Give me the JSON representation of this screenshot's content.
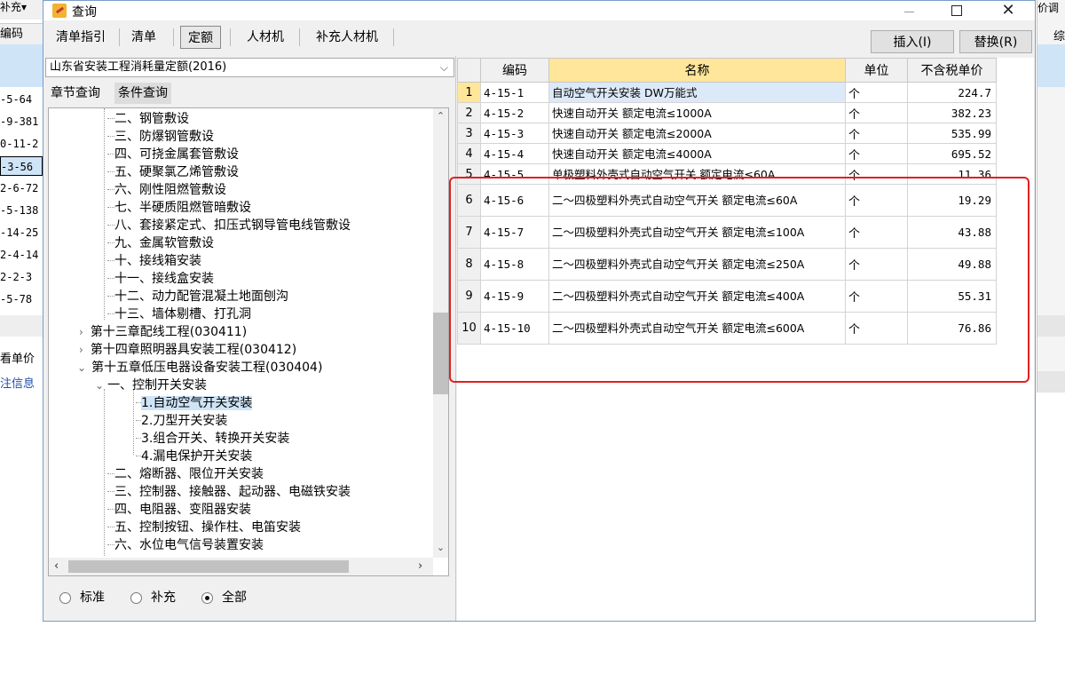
{
  "bg_left": {
    "menu_label": "补充",
    "header": "编码",
    "rows": [
      "-5-64",
      "-9-381",
      "0-11-2",
      "-3-56",
      "2-6-72",
      "-5-138",
      "-14-25",
      "2-4-14",
      "2-2-3",
      "-5-78"
    ],
    "label1": "看单价",
    "label2": "注信息"
  },
  "bg_right": {
    "top_text": "价调",
    "col_text": "综"
  },
  "dialog": {
    "title": "查询",
    "tabs": [
      "清单指引",
      "清单",
      "定额",
      "人材机",
      "补充人材机"
    ],
    "active_tab": "定额",
    "insert_button": "插入(I)",
    "replace_button": "替换(R)"
  },
  "library": {
    "selected": "山东省安装工程消耗量定额(2016)"
  },
  "subtabs": {
    "chapter": "章节查询",
    "condition": "条件查询"
  },
  "tree": [
    {
      "text": "二、钢管敷设"
    },
    {
      "text": "三、防爆钢管敷设"
    },
    {
      "text": "四、可挠金属套管敷设"
    },
    {
      "text": "五、硬聚氯乙烯管敷设"
    },
    {
      "text": "六、刚性阻燃管敷设"
    },
    {
      "text": "七、半硬质阻燃管暗敷设"
    },
    {
      "text": "八、套接紧定式、扣压式钢导管电线管敷设"
    },
    {
      "text": "九、金属软管敷设"
    },
    {
      "text": "十、接线箱安装"
    },
    {
      "text": "十一、接线盒安装"
    },
    {
      "text": "十二、动力配管混凝土地面刨沟"
    },
    {
      "text": "十三、墙体剔槽、打孔洞"
    },
    {
      "text": "第十三章配线工程(030411)"
    },
    {
      "text": "第十四章照明器具安装工程(030412)"
    },
    {
      "text": "第十五章低压电器设备安装工程(030404)"
    },
    {
      "text": "一、控制开关安装"
    },
    {
      "text": "1.自动空气开关安装"
    },
    {
      "text": "2.刀型开关安装"
    },
    {
      "text": "3.组合开关、转换开关安装"
    },
    {
      "text": "4.漏电保护开关安装"
    },
    {
      "text": "二、熔断器、限位开关安装"
    },
    {
      "text": "三、控制器、接触器、起动器、电磁铁安装"
    },
    {
      "text": "四、电阻器、变阻器安装"
    },
    {
      "text": "五、控制按钮、操作柱、电笛安装"
    },
    {
      "text": "六、水位电气信号装置安装"
    }
  ],
  "filter": {
    "standard": "标准",
    "supplement": "补充",
    "all": "全部"
  },
  "grid": {
    "columns": [
      "编码",
      "名称",
      "单位",
      "不含税单价"
    ],
    "rows": [
      {
        "n": "1",
        "code": "4-15-1",
        "name": "自动空气开关安装 DW万能式",
        "unit": "个",
        "price": "224.7"
      },
      {
        "n": "2",
        "code": "4-15-2",
        "name": "快速自动开关 额定电流≤1000A",
        "unit": "个",
        "price": "382.23"
      },
      {
        "n": "3",
        "code": "4-15-3",
        "name": "快速自动开关 额定电流≤2000A",
        "unit": "个",
        "price": "535.99"
      },
      {
        "n": "4",
        "code": "4-15-4",
        "name": "快速自动开关 额定电流≤4000A",
        "unit": "个",
        "price": "695.52"
      },
      {
        "n": "5",
        "code": "4-15-5",
        "name": "单极塑料外壳式自动空气开关 额定电流≤60A",
        "unit": "个",
        "price": "11.36"
      },
      {
        "n": "6",
        "code": "4-15-6",
        "name": "二～四极塑料外壳式自动空气开关 额定电流≤60A",
        "unit": "个",
        "price": "19.29"
      },
      {
        "n": "7",
        "code": "4-15-7",
        "name": "二～四极塑料外壳式自动空气开关 额定电流≤100A",
        "unit": "个",
        "price": "43.88"
      },
      {
        "n": "8",
        "code": "4-15-8",
        "name": "二～四极塑料外壳式自动空气开关 额定电流≤250A",
        "unit": "个",
        "price": "49.88"
      },
      {
        "n": "9",
        "code": "4-15-9",
        "name": "二～四极塑料外壳式自动空气开关 额定电流≤400A",
        "unit": "个",
        "price": "55.31"
      },
      {
        "n": "10",
        "code": "4-15-10",
        "name": "二～四极塑料外壳式自动空气开关 额定电流≤600A",
        "unit": "个",
        "price": "76.86"
      }
    ]
  },
  "colors": {
    "annotation": "#e02020",
    "selected": "#cfe4f7",
    "header_highlight": "#ffe69a"
  }
}
